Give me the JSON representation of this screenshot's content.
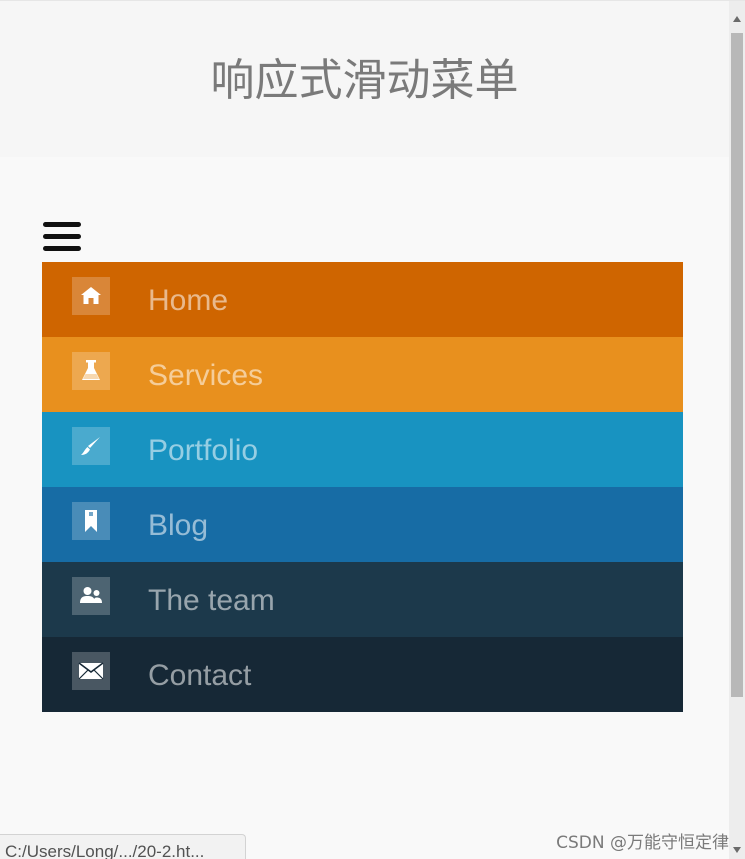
{
  "header": {
    "title": "响应式滑动菜单"
  },
  "menu": {
    "toggle_icon": "hamburger-menu-icon",
    "items": [
      {
        "label": "Home",
        "icon": "home-icon",
        "color": "#cf6500"
      },
      {
        "label": "Services",
        "icon": "flask-icon",
        "color": "#e8901e"
      },
      {
        "label": "Portfolio",
        "icon": "brush-icon",
        "color": "#1893c1"
      },
      {
        "label": "Blog",
        "icon": "bookmark-icon",
        "color": "#176ca5"
      },
      {
        "label": "The team",
        "icon": "team-icon",
        "color": "#1c394b"
      },
      {
        "label": "Contact",
        "icon": "envelope-icon",
        "color": "#162836"
      }
    ]
  },
  "statusbar": {
    "url": "C:/Users/Long/.../20-2.ht..."
  },
  "watermark": {
    "text": "CSDN @万能守恒定律"
  }
}
